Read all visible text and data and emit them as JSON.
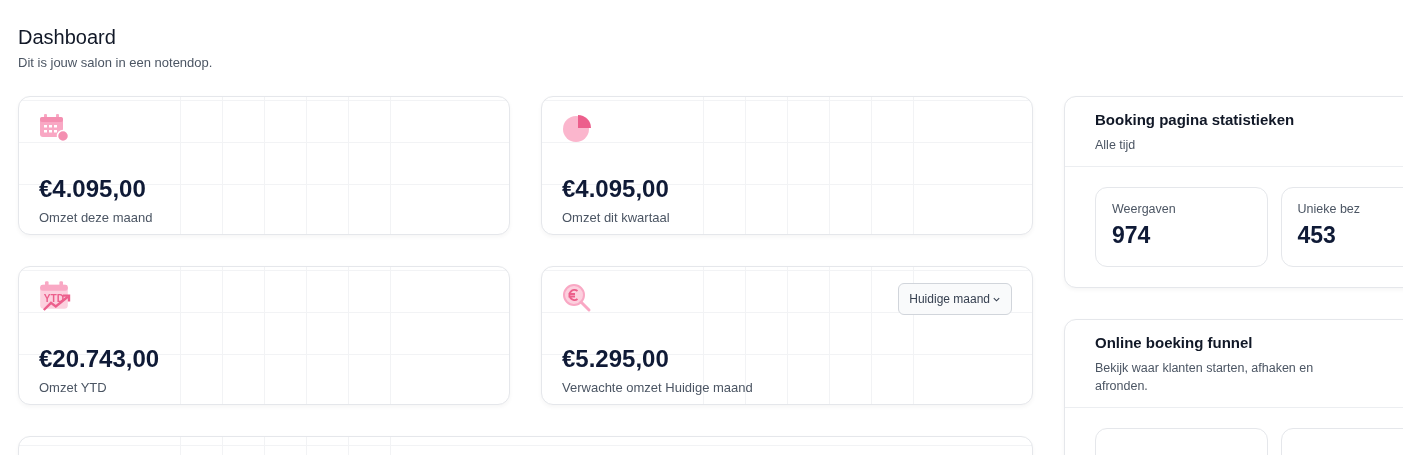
{
  "header": {
    "title": "Dashboard",
    "subtitle": "Dit is jouw salon in een notendop."
  },
  "stat_cards": [
    {
      "kind": "calendar-euro",
      "value": "€4.095,00",
      "label": "Omzet deze maand"
    },
    {
      "kind": "pie",
      "value": "€4.095,00",
      "label": "Omzet dit kwartaal"
    },
    {
      "kind": "calendar-ytd",
      "icon_text": "YTD",
      "value": "€20.743,00",
      "label": "Omzet YTD"
    },
    {
      "kind": "search-euro",
      "value": "€5.295,00",
      "label": "Verwachte omzet Huidige maand",
      "dropdown": "Huidige maand"
    }
  ],
  "booking_stats": {
    "title": "Booking pagina statistieken",
    "subtitle": "Alle tijd",
    "metrics": [
      {
        "label": "Weergaven",
        "value": "974"
      },
      {
        "label": "Unieke bez",
        "value": "453"
      }
    ]
  },
  "funnel": {
    "title": "Online boeking funnel",
    "description": "Bekijk waar klanten starten, afhaken en afronden."
  }
}
